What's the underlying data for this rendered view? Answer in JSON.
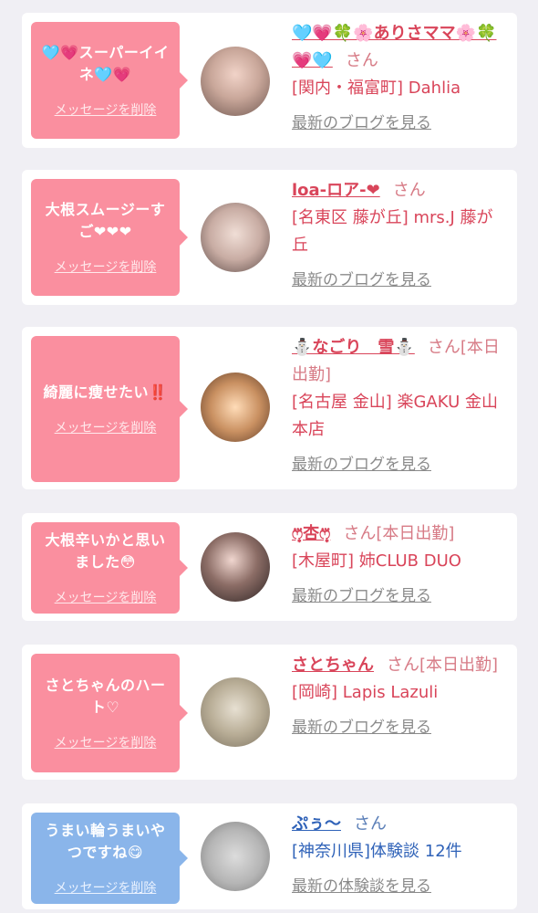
{
  "messages": [
    {
      "message": "🩵💗スーパーイイネ🩵💗",
      "delete_label": "メッセージを削除",
      "name": "🩵💗🍀🌸ありさママ🌸🍀💗🩵",
      "honorific": "さん",
      "shop": "[関内・福富町] Dahlia",
      "link": "最新のブログを見る",
      "bubble_color": "#fa8f9f"
    },
    {
      "message": "大根スムージーすご❤︎❤︎❤︎",
      "delete_label": "メッセージを削除",
      "name": "loa-ロア-❤︎",
      "honorific": "さん",
      "shop": "[名東区 藤が丘] mrs.J 藤が丘",
      "link": "最新のブログを見る",
      "bubble_color": "#fa8f9f"
    },
    {
      "message": "綺麗に痩せたい‼️",
      "delete_label": "メッセージを削除",
      "name": "⛄なごり　雪⛄",
      "honorific": "さん[本日出勤]",
      "shop": "[名古屋 金山] 楽GAKU 金山本店",
      "link": "最新のブログを見る",
      "bubble_color": "#fa8f9f"
    },
    {
      "message": "大根辛いかと思いました😳",
      "delete_label": "メッセージを削除",
      "name": "ෆ͙⃛杏ෆ͙⃛",
      "honorific": "さん[本日出勤]",
      "shop": "[木屋町] 姉CLUB DUO",
      "link": "最新のブログを見る",
      "bubble_color": "#fa8f9f"
    },
    {
      "message": "さとちゃんのハート♡",
      "delete_label": "メッセージを削除",
      "name": "さとちゃん",
      "honorific": "さん[本日出勤]",
      "shop": "[岡崎] Lapis Lazuli",
      "link": "最新のブログを見る",
      "bubble_color": "#fa8f9f"
    },
    {
      "message": "うまい輪うまいやつですね😋",
      "delete_label": "メッセージを削除",
      "name": "ぷぅ〜",
      "honorific": "さん",
      "shop": "[神奈川県]体験談 12件",
      "link": "最新の体験談を見る",
      "bubble_color": "#8ab5ea"
    }
  ]
}
